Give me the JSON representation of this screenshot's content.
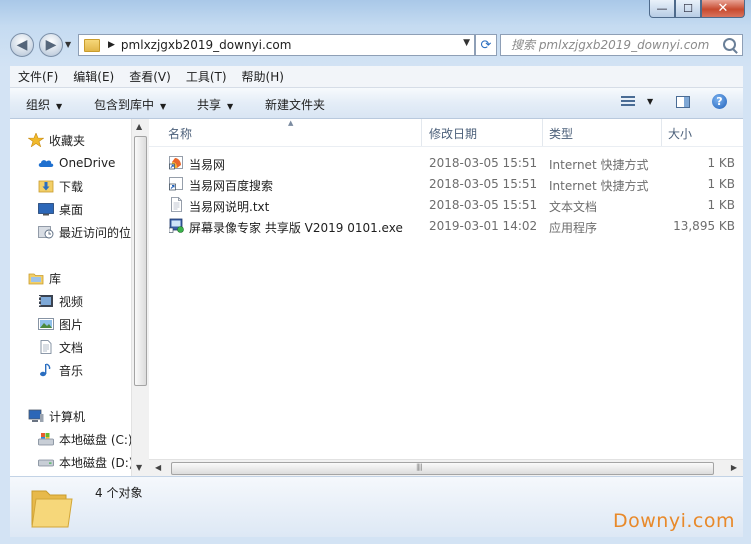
{
  "window": {
    "controls": {
      "minimize": "—",
      "maximize": "☐",
      "close": "✕"
    }
  },
  "address": {
    "path": "pmlxzjgxb2019_downyi.com"
  },
  "search": {
    "placeholder": "搜索 pmlxzjgxb2019_downyi.com"
  },
  "menu": [
    {
      "label": "文件(F)"
    },
    {
      "label": "编辑(E)"
    },
    {
      "label": "查看(V)"
    },
    {
      "label": "工具(T)"
    },
    {
      "label": "帮助(H)"
    }
  ],
  "toolbar": {
    "organize": "组织",
    "include_library": "包含到库中",
    "share": "共享",
    "new_folder": "新建文件夹"
  },
  "nav": {
    "favorites": "收藏夹",
    "onedrive": "OneDrive",
    "downloads": "下载",
    "desktop": "桌面",
    "recent": "最近访问的位置",
    "libraries": "库",
    "videos": "视频",
    "pictures": "图片",
    "documents": "文档",
    "music": "音乐",
    "computer": "计算机",
    "drive_c": "本地磁盘 (C:)",
    "drive_d": "本地磁盘 (D:)"
  },
  "columns": {
    "name": "名称",
    "modified": "修改日期",
    "type": "类型",
    "size": "大小"
  },
  "files": [
    {
      "name": "当易网",
      "modified": "2018-03-05 15:51",
      "type": "Internet 快捷方式",
      "size": "1 KB",
      "icon": "internet-shortcut-icon"
    },
    {
      "name": "当易网百度搜索",
      "modified": "2018-03-05 15:51",
      "type": "Internet 快捷方式",
      "size": "1 KB",
      "icon": "shortcut-icon"
    },
    {
      "name": "当易网说明.txt",
      "modified": "2018-03-05 15:51",
      "type": "文本文档",
      "size": "1 KB",
      "icon": "text-file-icon"
    },
    {
      "name": "屏幕录像专家 共享版 V2019 0101.exe",
      "modified": "2019-03-01 14:02",
      "type": "应用程序",
      "size": "13,895 KB",
      "icon": "exe-icon"
    }
  ],
  "status": {
    "count": "4 个对象"
  },
  "watermark": "Downyi.com",
  "colors": {
    "accent": "#2a6ec0",
    "watermark": "#e8892a",
    "folder": "#f2cf68"
  }
}
